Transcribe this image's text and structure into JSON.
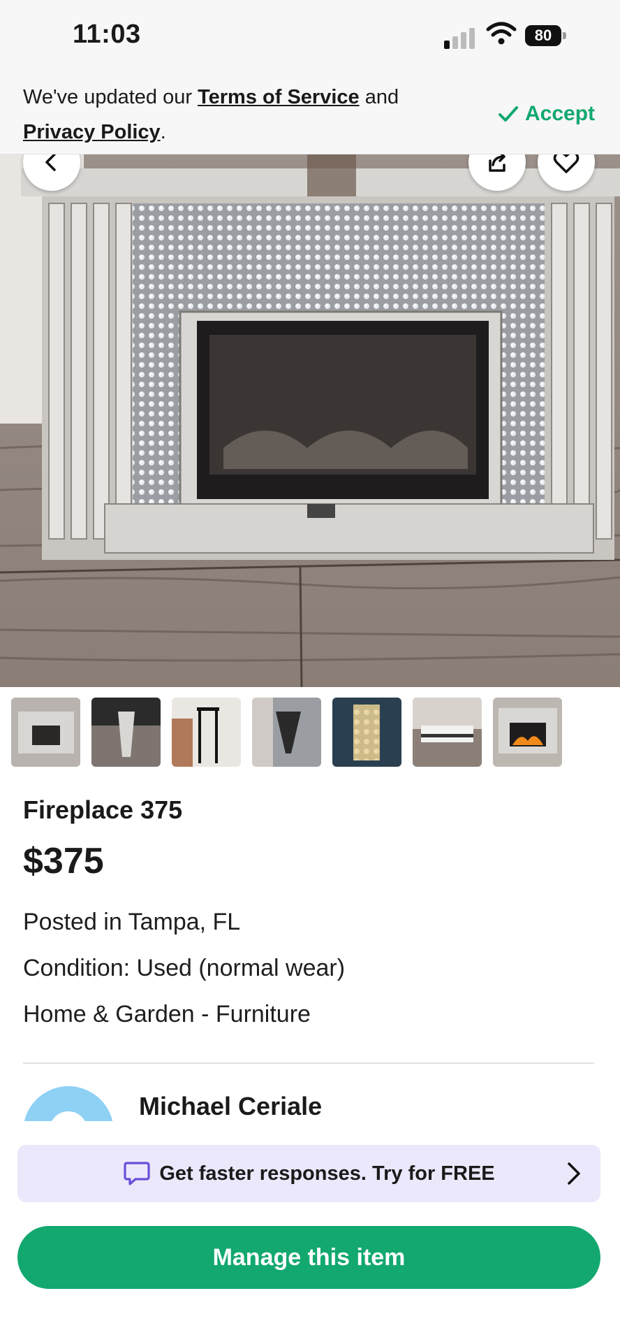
{
  "status_bar": {
    "time": "11:03",
    "battery": "80"
  },
  "terms_banner": {
    "prefix": "We've updated our ",
    "terms_link": "Terms of Service",
    "middle": " and",
    "privacy_link": "Privacy Policy",
    "suffix": ".",
    "accept_label": "Accept"
  },
  "item": {
    "title": "Fireplace 375",
    "price": "$375",
    "location": "Posted in Tampa, FL",
    "condition": "Condition: Used (normal wear)",
    "category": "Home & Garden - Furniture"
  },
  "seller": {
    "name": "Michael Ceriale"
  },
  "promo": {
    "text": "Get faster responses. Try for FREE"
  },
  "actions": {
    "manage_label": "Manage this item"
  },
  "colors": {
    "accent": "#12a86f",
    "promo_bg": "#ece8fb",
    "promo_icon": "#6a4fd8"
  },
  "icons": [
    "back-arrow-icon",
    "share-icon",
    "heart-icon",
    "checkmark-icon",
    "chat-bubble-icon",
    "chevron-right-icon"
  ]
}
